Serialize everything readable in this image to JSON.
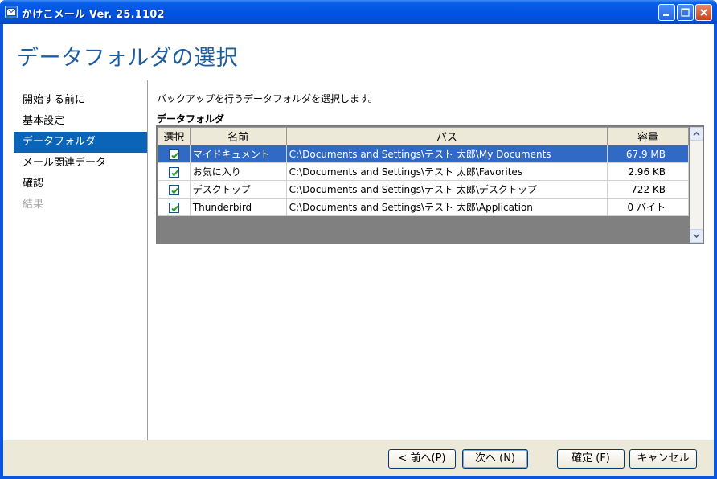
{
  "window": {
    "title": "かけこメール Ver. 25.1102",
    "icon": "mail-icon"
  },
  "page": {
    "title": "データフォルダの選択",
    "instruction": "バックアップを行うデータフォルダを選択します。",
    "group_label": "データフォルダ"
  },
  "nav": {
    "items": [
      {
        "label": "開始する前に",
        "state": "normal"
      },
      {
        "label": "基本設定",
        "state": "normal"
      },
      {
        "label": "データフォルダ",
        "state": "active"
      },
      {
        "label": "メール関連データ",
        "state": "normal"
      },
      {
        "label": "確認",
        "state": "normal"
      },
      {
        "label": "結果",
        "state": "disabled"
      }
    ]
  },
  "grid": {
    "columns": [
      "選択",
      "名前",
      "パス",
      "容量"
    ],
    "rows": [
      {
        "checked": true,
        "name": "マイドキュメント",
        "path": "C:\\Documents  and  Settings\\テスト 太郎\\My Documents",
        "size": "67.9 MB",
        "selected": true
      },
      {
        "checked": true,
        "name": "お気に入り",
        "path": "C:\\Documents  and  Settings\\テスト 太郎\\Favorites",
        "size": "2.96 KB",
        "selected": false
      },
      {
        "checked": true,
        "name": "デスクトップ",
        "path": "C:\\Documents  and  Settings\\テスト 太郎\\デスクトップ",
        "size": "722 KB",
        "selected": false
      },
      {
        "checked": true,
        "name": "Thunderbird",
        "path": "C:\\Documents  and  Settings\\テスト 太郎\\Application",
        "size": "0 バイト",
        "selected": false
      }
    ]
  },
  "footer": {
    "back_label": "< 前へ(P)",
    "next_label": "次へ (N)",
    "ok_label": "確定 (F)",
    "cancel_label": "キャンセル"
  },
  "colors": {
    "titlebar": "#0054e3",
    "heading": "#1b5d9e",
    "nav_active": "#0a65b8",
    "row_selected": "#316ac5",
    "footer_bg": "#ece9d8"
  }
}
